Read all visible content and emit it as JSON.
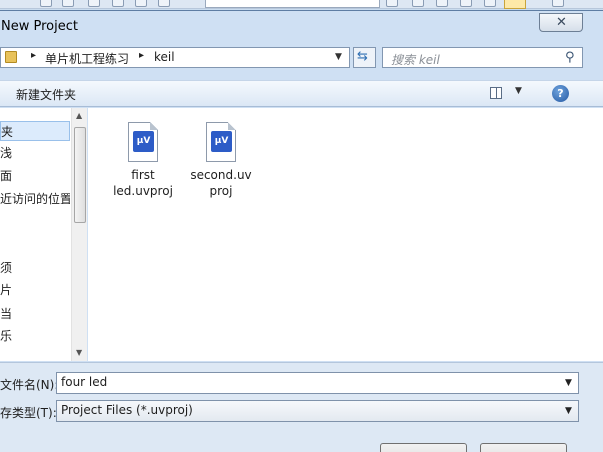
{
  "dialog": {
    "title": "New Project",
    "close_glyph": "✕"
  },
  "address": {
    "crumbs": [
      "单片机工程练习",
      "keil"
    ],
    "separator": "▸"
  },
  "search": {
    "placeholder": "搜索 keil"
  },
  "toolbar": {
    "new_folder": "新建文件夹",
    "help_glyph": "?"
  },
  "nav": {
    "items": [
      "夹",
      "浅",
      "面",
      "近访问的位置",
      "",
      "",
      "须",
      "片",
      "当",
      "乐"
    ]
  },
  "files": [
    {
      "name_line1": "first",
      "name_line2": "led.uvproj",
      "badge": "μV"
    },
    {
      "name_line1": "second.uv",
      "name_line2": "proj",
      "badge": "μV"
    }
  ],
  "form": {
    "filename_label": "文件名(N):",
    "filename_value": "four led",
    "filetype_label": "存类型(T):",
    "filetype_value": "Project Files (*.uvproj)"
  }
}
